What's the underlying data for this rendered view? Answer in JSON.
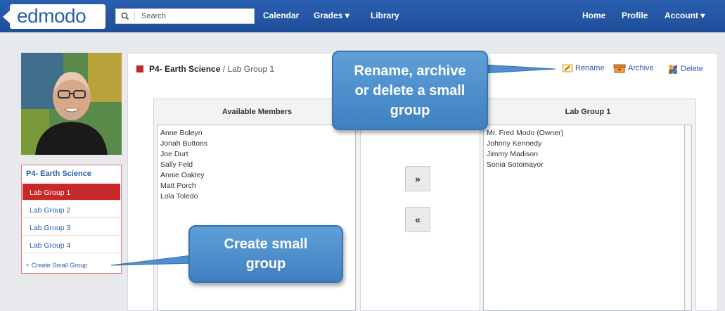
{
  "nav": {
    "logo": "edmodo",
    "search_placeholder": "Search",
    "links": {
      "calendar": "Calendar",
      "grades": "Grades ▾",
      "library": "Library",
      "home": "Home",
      "profile": "Profile",
      "account": "Account ▾"
    }
  },
  "sidebar": {
    "course_title": "P4- Earth Science",
    "groups": [
      "Lab Group 1",
      "Lab Group 2",
      "Lab Group 3",
      "Lab Group 4"
    ],
    "create_link": "+ Create Small Group"
  },
  "main": {
    "breadcrumb": {
      "course": "P4- Earth Science",
      "separator": " / ",
      "group": "Lab Group 1"
    },
    "actions": {
      "rename": "Rename",
      "archive": "Archive",
      "delete": "Delete"
    },
    "available": {
      "header": "Available Members",
      "members": [
        "Anne Boleyn",
        "Jonah Buttons",
        "Joe Durt",
        "Sally Feld",
        "Annie Oakley",
        "Matt Porch",
        "Lola Toledo"
      ]
    },
    "group": {
      "header": "Lab Group 1",
      "members": [
        "Mr. Fred Modo (Owner)",
        "Johnny Kennedy",
        "Jimmy Madison",
        "Sonia Sotomayor"
      ]
    },
    "buttons": {
      "add": "»",
      "remove": "«"
    }
  },
  "callouts": {
    "rename_archive": [
      "Rename, archive",
      "or delete a small",
      "group"
    ],
    "create": [
      "Create small",
      "group"
    ]
  },
  "colors": {
    "nav_blue": "#2a5fb0",
    "active_red": "#c7282a",
    "callout_blue": "#4f8fcf"
  },
  "icons": [
    "search-icon",
    "rename-icon",
    "archive-icon",
    "delete-icon"
  ]
}
